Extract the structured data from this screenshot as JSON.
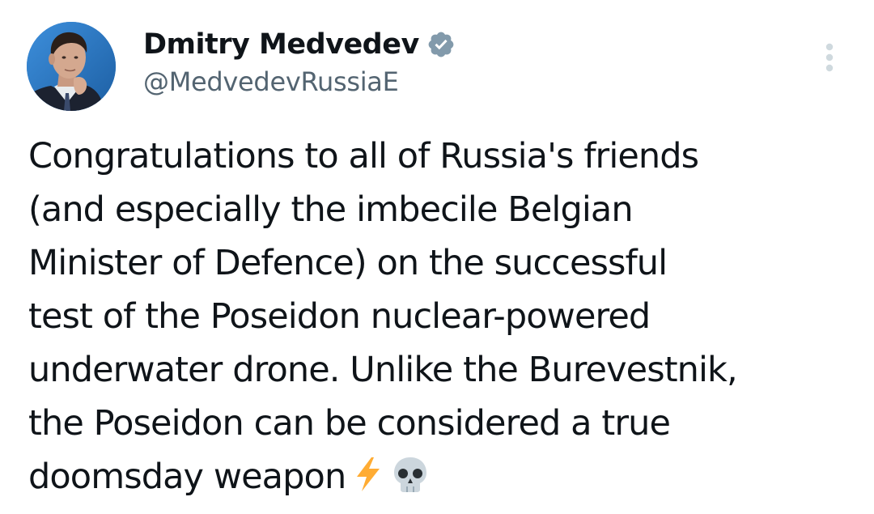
{
  "author": {
    "display_name": "Dmitry Medvedev",
    "handle": "@MedvedevRussiaE",
    "verified_icon": "verified-badge-icon",
    "avatar": "profile-photo"
  },
  "menu": {
    "icon": "more-vertical-icon"
  },
  "tweet": {
    "lines": [
      "Congratulations to all of Russia's friends",
      "(and especially the imbecile Belgian",
      "Minister of Defence) on the successful",
      "test of the Poseidon nuclear-powered",
      "underwater drone. Unlike the Burevestnik,",
      "the Poseidon can be considered a true",
      "doomsday weapon"
    ],
    "emojis": [
      "high-voltage-emoji",
      "skull-emoji"
    ]
  },
  "colors": {
    "text": "#0f1419",
    "secondary": "#536471",
    "verified_gray": "#829aab",
    "menu_dots": "#cfd9de",
    "lightning": "#ffac33",
    "avatar_bg": "#2b79c7"
  }
}
